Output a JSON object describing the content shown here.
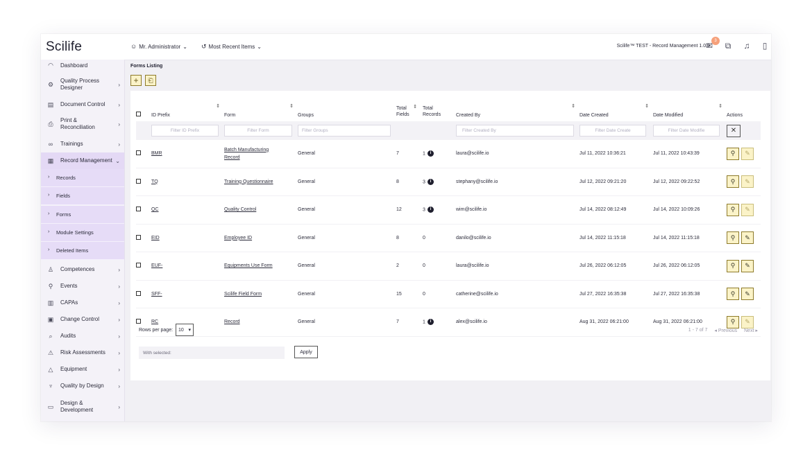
{
  "app": {
    "logo": "Scilife"
  },
  "topbar": {
    "user": "Mr. Administrator",
    "recent": "Most Recent Items",
    "environment": "Scilife™ TEST - Record Management 1.0.0",
    "notifications_count": "3"
  },
  "sidebar": {
    "items": [
      {
        "label": "Dashboard",
        "icon": "gauge-icon"
      },
      {
        "label": "Quality Process Designer",
        "icon": "process-icon"
      },
      {
        "label": "Document Control",
        "icon": "document-icon"
      },
      {
        "label": "Print & Reconciliation",
        "icon": "printer-icon"
      },
      {
        "label": "Trainings",
        "icon": "glasses-icon"
      },
      {
        "label": "Record Management",
        "icon": "record-icon"
      },
      {
        "label": "Competences",
        "icon": "competence-icon"
      },
      {
        "label": "Events",
        "icon": "event-icon"
      },
      {
        "label": "CAPAs",
        "icon": "capa-icon"
      },
      {
        "label": "Change Control",
        "icon": "change-icon"
      },
      {
        "label": "Audits",
        "icon": "audit-icon"
      },
      {
        "label": "Risk Assessments",
        "icon": "warning-icon"
      },
      {
        "label": "Equipment",
        "icon": "equipment-icon"
      },
      {
        "label": "Quality by Design",
        "icon": "design-icon"
      },
      {
        "label": "Design & Development",
        "icon": "development-icon"
      }
    ],
    "subitems": [
      "Records",
      "Fields",
      "Forms",
      "Module Settings",
      "Deleted Items"
    ]
  },
  "page": {
    "breadcrumb": "Forms Listing"
  },
  "table": {
    "headers": {
      "id_prefix": "ID Prefix",
      "form": "Form",
      "groups": "Groups",
      "total_fields": "Total Fields",
      "total_records": "Total Records",
      "created_by": "Created By",
      "date_created": "Date Created",
      "date_modified": "Date Modified",
      "actions": "Actions"
    },
    "filters": {
      "id_prefix": "Filter ID Prefix",
      "form": "Filter Form",
      "groups": "Filter Groups",
      "created_by": "Filter Created By",
      "date_created": "Filter Date Create",
      "date_modified": "Filter Date Modifie"
    },
    "rows": [
      {
        "prefix": "BMR",
        "form": "Batch Manufacturing Record",
        "group": "General",
        "fields": "7",
        "records": "1",
        "info": true,
        "created_by": "laura@scilife.io",
        "created": "Jul 11, 2022 10:36:21",
        "modified": "Jul 11, 2022 10:43:39",
        "edit_enabled": false
      },
      {
        "prefix": "TQ",
        "form": "Training Questionnaire",
        "group": "General",
        "fields": "8",
        "records": "3",
        "info": true,
        "created_by": "stephany@scilife.io",
        "created": "Jul 12, 2022 09:21:20",
        "modified": "Jul 12, 2022 09:22:52",
        "edit_enabled": false
      },
      {
        "prefix": "QC",
        "form": "Quality Control",
        "group": "General",
        "fields": "12",
        "records": "3",
        "info": true,
        "created_by": "wim@scilife.io",
        "created": "Jul 14, 2022 08:12:49",
        "modified": "Jul 14, 2022 10:09:26",
        "edit_enabled": false
      },
      {
        "prefix": "EID",
        "form": "Employee ID",
        "group": "General",
        "fields": "8",
        "records": "0",
        "info": false,
        "created_by": "danilo@scilife.io",
        "created": "Jul 14, 2022 11:15:18",
        "modified": "Jul 14, 2022 11:15:18",
        "edit_enabled": true
      },
      {
        "prefix": "EUF-",
        "form": "Equipments Use Form",
        "group": "General",
        "fields": "2",
        "records": "0",
        "info": false,
        "created_by": "laura@scilife.io",
        "created": "Jul 26, 2022 06:12:05",
        "modified": "Jul 26, 2022 06:12:05",
        "edit_enabled": true
      },
      {
        "prefix": "SFF-",
        "form": "Scilife Field Form",
        "group": "General",
        "fields": "15",
        "records": "0",
        "info": false,
        "created_by": "catherine@scilife.io",
        "created": "Jul 27, 2022 16:35:38",
        "modified": "Jul 27, 2022 16:35:38",
        "edit_enabled": true
      },
      {
        "prefix": "RC",
        "form": "Record",
        "group": "General",
        "fields": "7",
        "records": "1",
        "info": true,
        "created_by": "alex@scilife.io",
        "created": "Aug 31, 2022 06:21:00",
        "modified": "Aug 31, 2022 06:21:00",
        "edit_enabled": false
      }
    ]
  },
  "footer": {
    "rows_per_page_label": "Rows per page:",
    "rows_per_page_value": "10",
    "range": "1 - 7 of 7",
    "previous": "Previous",
    "next": "Next",
    "with_selected": "With selected:",
    "apply": "Apply"
  }
}
